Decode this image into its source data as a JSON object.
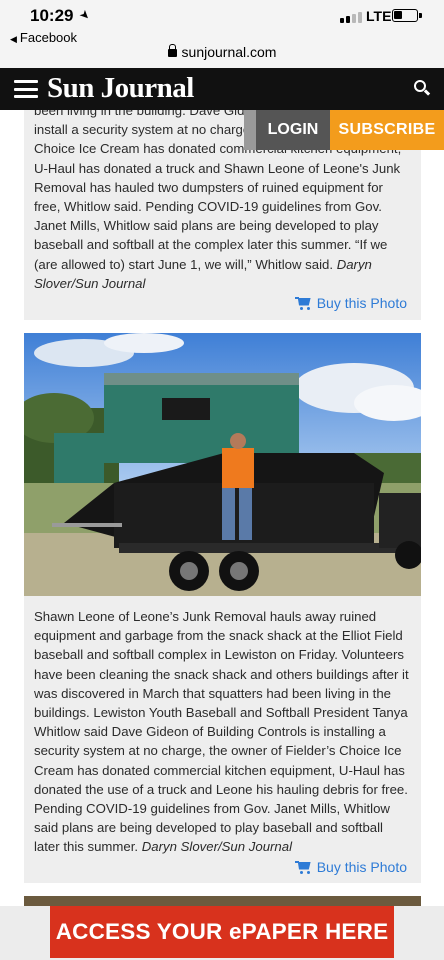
{
  "status_bar": {
    "time": "10:29",
    "carrier": "LTE"
  },
  "browser": {
    "back_app": "Facebook",
    "url": "sunjournal.com"
  },
  "site": {
    "brand": "Sun Journal",
    "login_label": "LOGIN",
    "subscribe_label": "SUBSCRIBE"
  },
  "articles": [
    {
      "caption": "been living in the building. Dave Gideon of Building Controls will install a security system at no charge, the owner of Fielder's Choice Ice Cream has donated commercial kitchen equipment, U-Haul has donated a truck and Shawn Leone of Leone's Junk Removal has hauled two dumpsters of ruined equipment for free, Whitlow said. Pending COVID-19 guidelines from Gov. Janet Mills, Whitlow said plans are being developed to play baseball and softball at the complex later this summer. “If we (are allowed to) start June 1, we will,” Whitlow said.",
      "credit": "Daryn Slover/Sun Journal",
      "buy_label": "Buy this Photo"
    },
    {
      "caption": "Shawn Leone of Leone’s Junk Removal hauls away ruined equipment and garbage from the snack shack at the Elliot Field baseball and softball complex in Lewiston on Friday. Volunteers have been cleaning the snack shack and others buildings after it was discovered in March that squatters had been living in the buildings. Lewiston Youth Baseball and Softball President Tanya Whitlow said Dave Gideon of Building Controls is installing a security system at no charge, the owner of Fielder’s Choice Ice Cream has donated commercial kitchen equipment, U-Haul has donated the use of a truck and Leone his hauling debris for free. Pending COVID-19 guidelines from Gov. Janet Mills, Whitlow said plans are being developed to play baseball and softball later this summer.",
      "credit": "Daryn Slover/Sun Journal",
      "buy_label": "Buy this Photo"
    }
  ],
  "ad": {
    "text": "ACCESS YOUR ePAPER HERE"
  },
  "colors": {
    "header_bg": "#111111",
    "subscribe": "#f39c1c",
    "link": "#2e7bd6",
    "ad_red": "#d8321d"
  }
}
